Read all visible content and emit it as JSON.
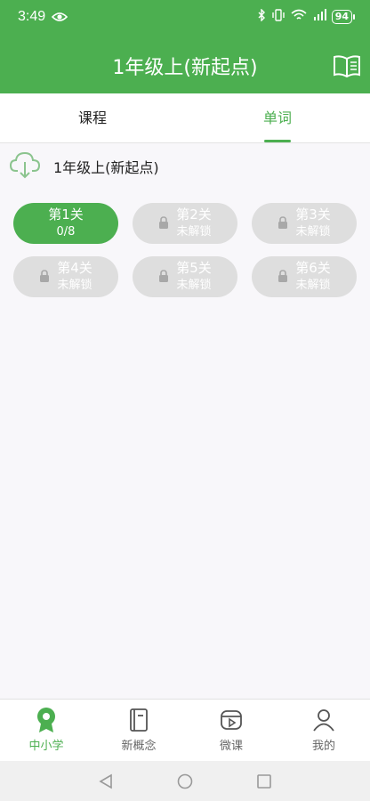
{
  "status_bar": {
    "time": "3:49",
    "battery": "94"
  },
  "header": {
    "title": "1年级上(新起点)"
  },
  "tabs": [
    {
      "label": "课程",
      "active": false
    },
    {
      "label": "单词",
      "active": true
    }
  ],
  "book": {
    "name": "1年级上(新起点)"
  },
  "levels": [
    {
      "name": "第1关",
      "sub": "0/8",
      "locked": false
    },
    {
      "name": "第2关",
      "sub": "未解锁",
      "locked": true
    },
    {
      "name": "第3关",
      "sub": "未解锁",
      "locked": true
    },
    {
      "name": "第4关",
      "sub": "未解锁",
      "locked": true
    },
    {
      "name": "第5关",
      "sub": "未解锁",
      "locked": true
    },
    {
      "name": "第6关",
      "sub": "未解锁",
      "locked": true
    }
  ],
  "bottom_nav": [
    {
      "label": "中小学",
      "icon": "badge-icon",
      "active": true
    },
    {
      "label": "新概念",
      "icon": "notebook-icon",
      "active": false
    },
    {
      "label": "微课",
      "icon": "video-icon",
      "active": false
    },
    {
      "label": "我的",
      "icon": "person-icon",
      "active": false
    }
  ],
  "colors": {
    "accent": "#4caf50",
    "locked": "#dedede",
    "background": "#f8f7fa"
  }
}
